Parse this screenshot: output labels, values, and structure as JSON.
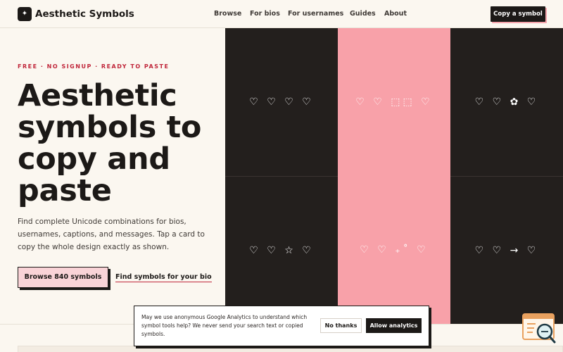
{
  "header": {
    "logo_glyph": "✦",
    "brand": "Aesthetic Symbols",
    "nav": [
      "Browse",
      "For bios",
      "For usernames",
      "Guides",
      "About"
    ],
    "cta": "Copy a symbol"
  },
  "hero": {
    "eyebrow": "FREE · NO SIGNUP · READY TO PASTE",
    "title_lines": [
      "Aesthetic",
      "symbols to",
      "copy and",
      "paste"
    ],
    "description": "Find complete Unicode combinations for bios, usernames, captions, and messages. Tap a card to copy the whole design exactly as shown.",
    "primary_button": "Browse 840 symbols",
    "secondary_link": "Find symbols for your bio"
  },
  "tiles": [
    {
      "symbols": "♡ ♡ ♡ ♡",
      "style": "dark"
    },
    {
      "symbols": "♡ ♡ ⬚⬚ ♡",
      "style": "pink"
    },
    {
      "symbols": "♡ ♡ ✿ ♡",
      "style": "dark"
    },
    {
      "symbols": "♡ ♡ ☆ ♡",
      "style": "dark"
    },
    {
      "symbols": "♡ ♡ ₊˚ ♡",
      "style": "pink"
    },
    {
      "symbols": "♡ ♡ → ♡",
      "style": "dark"
    }
  ],
  "cookie": {
    "text": "May we use anonymous Google Analytics to understand which symbol tools help? We never send your search text or copied symbols.",
    "decline": "No thanks",
    "accept": "Allow analytics"
  },
  "widget": {
    "icon": "search-assistant-icon"
  },
  "colors": {
    "accent_pink": "#f8a1a9",
    "dark": "#231f1d",
    "eyebrow_red": "#c0263a",
    "background": "#fbf7f0"
  }
}
